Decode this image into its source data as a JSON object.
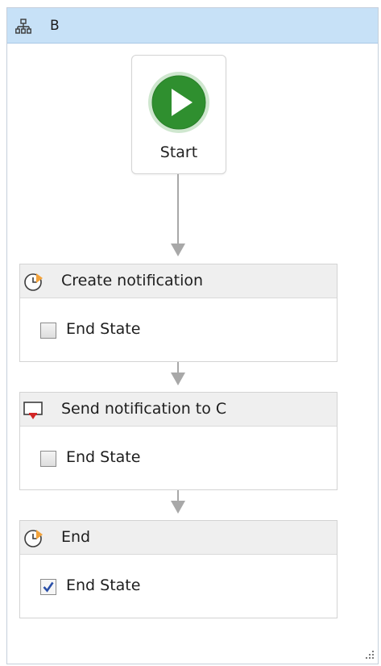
{
  "workflow": {
    "title": "B",
    "header_icon": "hierarchy-icon"
  },
  "start": {
    "label": "Start",
    "icon": "play-icon",
    "icon_color": "#2f8f2f"
  },
  "states": [
    {
      "title": "Create notification",
      "icon": "clock-icon",
      "end_state_label": "End State",
      "end_state_checked": false
    },
    {
      "title": "Send notification to C",
      "icon": "message-icon",
      "end_state_label": "End State",
      "end_state_checked": false
    },
    {
      "title": "End",
      "icon": "clock-icon",
      "end_state_label": "End State",
      "end_state_checked": true
    }
  ],
  "colors": {
    "header_bg": "#c7e1f7",
    "connector": "#a8a8a8",
    "checkmark": "#2a4fa8"
  }
}
